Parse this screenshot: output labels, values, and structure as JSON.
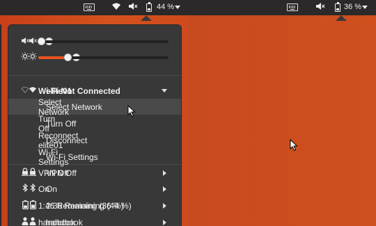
{
  "left": {
    "topbar": {
      "battery_percent": "44 %"
    },
    "sliders": {
      "volume": 0.0,
      "brightness": 0.22
    },
    "wifi": {
      "network": "elite01"
    },
    "submenu": [
      "Select Network",
      "Turn Off",
      "Disconnect",
      "Wi-Fi Settings"
    ],
    "highlighted_index": 0,
    "vpn": "VPN Off",
    "bluetooth": "On",
    "power": "2:36 Remaining (44 %)",
    "user": "handbook"
  },
  "right": {
    "topbar": {
      "battery_percent": "36 %"
    },
    "sliders": {
      "volume": 0.0,
      "brightness": 0.22
    },
    "wifi": {
      "network": "Wi-Fi Not Connected"
    },
    "submenu": [
      "Select Network",
      "Turn Off",
      "Reconnect elite01",
      "Wi-Fi Settings"
    ],
    "highlighted_index": 2,
    "vpn": "VPN Off",
    "bluetooth": "On",
    "power": "1:46 Remaining (36 %)",
    "user": "handbook"
  },
  "icons": {
    "keyboard": "keyboard-icon",
    "wifi": "wifi-icon",
    "volume_muted": "volume-muted-icon",
    "battery": "battery-icon",
    "brightness": "brightness-icon",
    "vpn": "vpn-lock-icon",
    "bluetooth": "bluetooth-icon",
    "user": "user-icon"
  },
  "colors": {
    "accent": "#e95420",
    "menu_bg": "#383838",
    "topbar": "#2b2929",
    "desktop": "#c9431a"
  }
}
